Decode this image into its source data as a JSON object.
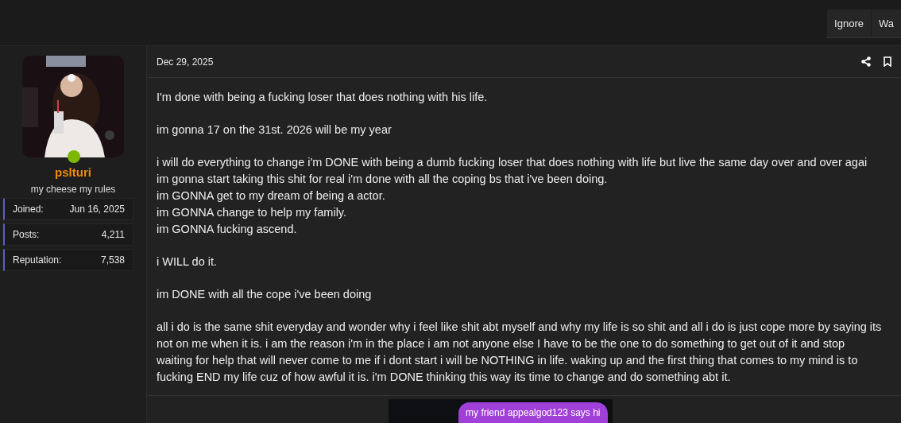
{
  "top_actions": [
    "Ignore",
    "Wa"
  ],
  "user": {
    "name": "pslturi",
    "title": "my cheese my rules",
    "online": true,
    "stats": [
      {
        "label": "Joined:",
        "value": "Jun 16, 2025"
      },
      {
        "label": "Posts:",
        "value": "4,211"
      },
      {
        "label": "Reputation:",
        "value": "7,538"
      }
    ]
  },
  "post": {
    "date": "Dec 29, 2025",
    "paragraphs": [
      {
        "lines": [
          "I'm done with being a fucking loser that does nothing with his life."
        ]
      },
      {
        "lines": [
          "im gonna 17 on the 31st. 2026 will be my year"
        ]
      },
      {
        "lines": [
          "i will do everything to change i'm DONE with being a dumb fucking loser that does nothing with life but live the same day over and over agai",
          "im gonna start taking this shit for real i'm done with all the coping bs that i've been doing.",
          "im GONNA get to my dream of being a actor.",
          "im GONNA change to help my family.",
          "im GONNA fucking ascend."
        ]
      },
      {
        "lines": [
          "i WILL do it."
        ]
      },
      {
        "lines": [
          "im DONE with all the cope i've been doing"
        ]
      },
      {
        "lines": [
          "all i do is the same shit everyday and wonder why i feel like shit abt myself and why my life is so shit and all i do is just cope more by saying its",
          "not on me when it is. i am the reason i'm in the place i am not anyone else I have to be the one to do something to get out of it and stop",
          "waiting for help that will never come to me if i dont start i will be NOTHING in life. waking up and the first thing that comes to my mind is to",
          "fucking END my life cuz of how awful it is. i'm DONE thinking this way its time to change and do something abt it."
        ]
      }
    ],
    "attachment": {
      "bubble": "my friend appealgod123 says hi"
    }
  }
}
